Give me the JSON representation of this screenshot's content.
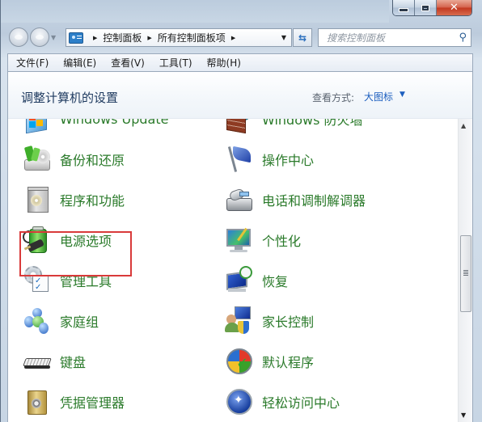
{
  "window": {
    "caption_buttons": [
      "minimize",
      "maximize",
      "close"
    ]
  },
  "navigation": {
    "back_icon": "back-arrow-icon",
    "forward_icon": "forward-arrow-icon",
    "recent_dropdown_icon": "chevron-down-icon"
  },
  "address_bar": {
    "breadcrumbs": [
      "控制面板",
      "所有控制面板项"
    ],
    "refresh_icon": "refresh-icon"
  },
  "search": {
    "placeholder": "搜索控制面板",
    "icon": "search-icon"
  },
  "menu": {
    "items": [
      "文件(F)",
      "编辑(E)",
      "查看(V)",
      "工具(T)",
      "帮助(H)"
    ]
  },
  "content": {
    "title": "调整计算机的设置",
    "view_by_label": "查看方式:",
    "view_by_value": "大图标"
  },
  "items": {
    "left": [
      {
        "label": "Windows Update",
        "icon": "windows-update-icon"
      },
      {
        "label": "备份和还原",
        "icon": "backup-restore-icon"
      },
      {
        "label": "程序和功能",
        "icon": "programs-features-icon"
      },
      {
        "label": "电源选项",
        "icon": "power-options-icon",
        "highlighted": true
      },
      {
        "label": "管理工具",
        "icon": "admin-tools-icon"
      },
      {
        "label": "家庭组",
        "icon": "homegroup-icon"
      },
      {
        "label": "键盘",
        "icon": "keyboard-icon"
      },
      {
        "label": "凭据管理器",
        "icon": "credential-manager-icon"
      }
    ],
    "right": [
      {
        "label": "Windows 防火墙",
        "icon": "firewall-icon"
      },
      {
        "label": "操作中心",
        "icon": "action-center-flag-icon"
      },
      {
        "label": "电话和调制解调器",
        "icon": "phone-modem-icon"
      },
      {
        "label": "个性化",
        "icon": "personalization-icon"
      },
      {
        "label": "恢复",
        "icon": "recovery-icon"
      },
      {
        "label": "家长控制",
        "icon": "parental-controls-icon"
      },
      {
        "label": "默认程序",
        "icon": "default-programs-icon"
      },
      {
        "label": "轻松访问中心",
        "icon": "ease-of-access-icon"
      }
    ]
  },
  "colors": {
    "item_text": "#2a7a2a",
    "link_blue": "#1d5fbf",
    "highlight_border": "#d93a3a"
  }
}
